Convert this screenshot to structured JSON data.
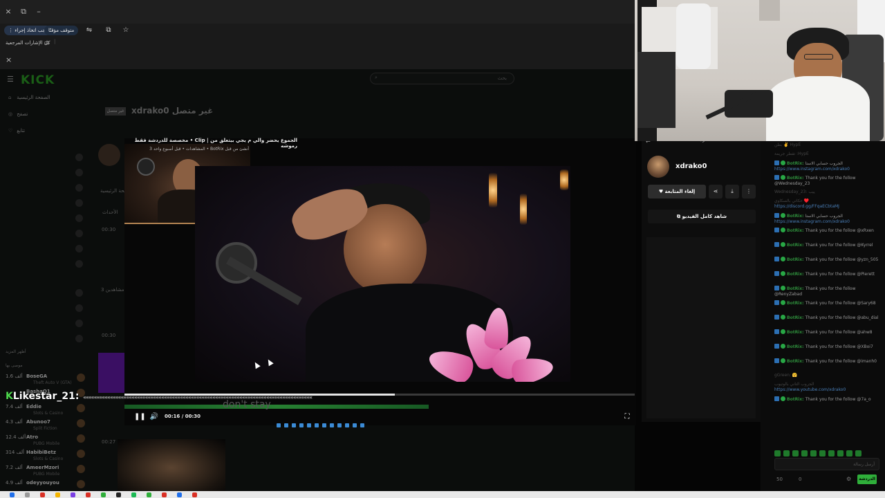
{
  "browser": {
    "window_close": "×",
    "window_restore": "⧉",
    "window_minimize": "–",
    "action_pill": "⋮ يجب اتخاذ إجراء",
    "paused_pill": "متوقف مؤقتًا",
    "bookmarks_label": "كل الإشارات المرجعية",
    "tab_close": "×"
  },
  "kick": {
    "logo": "KICK",
    "search_placeholder": "بحث",
    "nav": [
      "الصفحة الرئيسية",
      "تصفح",
      "تتابع"
    ],
    "channel_title": "xdrako0 غير متصل",
    "offline_badge": "غير متصل",
    "home_tab": "فحة الرئيسية",
    "events_tab": "الأحداث",
    "ts1": "00:30",
    "ts2": "00:30",
    "ts3": "00:27",
    "viewers_label": "مشاهدين 3",
    "recommended_header": "موصى بها",
    "show_more": "أظهر المزيد",
    "recommended": [
      {
        "views": "1.6 ألف",
        "name": "BoseGA",
        "sub": "Theft Auto V (GTA)"
      },
      {
        "views": "",
        "name": "BashaQ1",
        "sub": ""
      },
      {
        "views": "7.4 ألف",
        "name": "Eddie",
        "sub": "Slots & Casino"
      },
      {
        "views": "4.3 ألف",
        "name": "Abunoo7",
        "sub": "Split Fiction"
      },
      {
        "views": "12.4 ألف",
        "name": "Atro",
        "sub": "PUBG Mobile"
      },
      {
        "views": "314 ألف",
        "name": "HabibiBetz",
        "sub": "Slots & Casino"
      },
      {
        "views": "7.2 ألف",
        "name": "AmeerMzori",
        "sub": "PUBG Mobile"
      },
      {
        "views": "4.9 ألف",
        "name": "odeyyouyou",
        "sub": ""
      }
    ]
  },
  "clip": {
    "title": "مخصصة للدردشة فقط • Clip | الجموع يحضر والي م يجي بيتعلق من رموشه",
    "subtitle": "المشاهدات • قبل أسبوع واحد 3 • BotRix أنشئ من قبل",
    "time": "00:16 / 00:30",
    "progress": 0.53,
    "overlay_text": "Likestar_21:",
    "overlay_k": "K",
    "watermark": "don't stay"
  },
  "panel": {
    "header": "مترجمة",
    "streamer": "xdrako0",
    "unfollow": "♥ إلغاء المتابعة",
    "watch_full": "شاهد كامل الفيديو"
  },
  "chat": {
    "messages": [
      {
        "user": "",
        "text": "بطن ✌️ HypE",
        "link": "",
        "dim": true
      },
      {
        "user": "",
        "text": "تفطر جريمة :HypE",
        "link": "",
        "dim": true
      },
      {
        "user": "BotRix:",
        "text": "الجروب حسابي الاستا",
        "link": "https://www.instagram.com/xdrako0",
        "dim": false
      },
      {
        "user": "BotRix:",
        "text": "Thank you for the follow @Wednesday_23",
        "link": "",
        "dim": false
      },
      {
        "user": "",
        "text": "Wednesday_23: ييب",
        "link": "",
        "dim": true
      },
      {
        "user": "",
        "text": "حكاتي بالسكاوي ♥️",
        "link": "https://discord.gg/FFqaECbtaMJ",
        "dim": true
      },
      {
        "user": "BotRix:",
        "text": "الجروب حسابي الاستا",
        "link": "https://www.instagram.com/xdrako0",
        "dim": false
      },
      {
        "user": "BotRix:",
        "text": "Thank you for the follow @xRxen",
        "link": "",
        "dim": false
      },
      {
        "user": "BotRix:",
        "text": "Thank you for the follow @Kyrrel",
        "link": "",
        "dim": false
      },
      {
        "user": "BotRix:",
        "text": "Thank you for the follow @yzn_505",
        "link": "",
        "dim": false
      },
      {
        "user": "BotRix:",
        "text": "Thank you for the follow @Pierett",
        "link": "",
        "dim": false
      },
      {
        "user": "BotRix:",
        "text": "Thank you for the follow @RenyZabad",
        "link": "",
        "dim": false
      },
      {
        "user": "BotRix:",
        "text": "Thank you for the follow @Sary68",
        "link": "",
        "dim": false
      },
      {
        "user": "BotRix:",
        "text": "Thank you for the follow @abu_dial",
        "link": "",
        "dim": false
      },
      {
        "user": "BotRix:",
        "text": "Thank you for the follow @ahw8",
        "link": "",
        "dim": false
      },
      {
        "user": "BotRix:",
        "text": "Thank you for the follow @XBoi7",
        "link": "",
        "dim": false
      },
      {
        "user": "BotRix:",
        "text": "Thank you for the follow @imanh0",
        "link": "",
        "dim": false
      },
      {
        "user": "",
        "text": "gGreen: 🤗",
        "link": "",
        "dim": true
      },
      {
        "user": "",
        "text": "الجروب التاني بالوتيوب",
        "link": "https://www.youtube.com/xdrako0",
        "dim": true
      },
      {
        "user": "BotRix:",
        "text": "Thank you for the follow @7a_o",
        "link": "",
        "dim": false
      }
    ],
    "input_placeholder": "أرسل رسالة",
    "send_label": "الدردشة",
    "count_a": "50",
    "count_b": "0"
  }
}
